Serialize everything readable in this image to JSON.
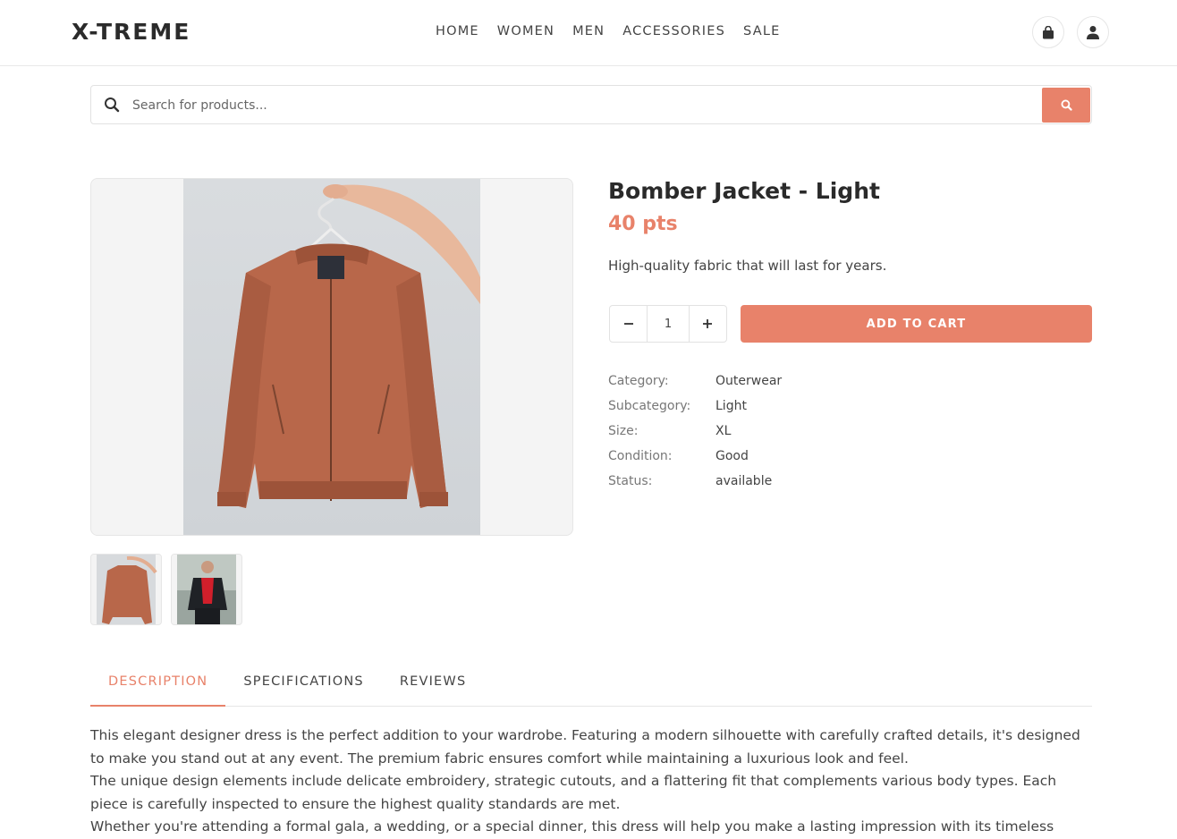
{
  "header": {
    "logo": "X-TREME",
    "nav": [
      "HOME",
      "WOMEN",
      "MEN",
      "ACCESSORIES",
      "SALE"
    ],
    "icons": [
      "shopping-bag-icon",
      "user-icon"
    ]
  },
  "search": {
    "placeholder": "Search for products..."
  },
  "product": {
    "title": "Bomber Jacket - Light",
    "price": "40 pts",
    "short_description": "High-quality fabric that will last for years.",
    "quantity": "1",
    "add_to_cart_label": "ADD TO CART",
    "specs": [
      {
        "label": "Category:",
        "value": "Outerwear"
      },
      {
        "label": "Subcategory:",
        "value": "Light"
      },
      {
        "label": "Size:",
        "value": "XL"
      },
      {
        "label": "Condition:",
        "value": "Good"
      },
      {
        "label": "Status:",
        "value": "available"
      }
    ]
  },
  "tabs": [
    "DESCRIPTION",
    "SPECIFICATIONS",
    "REVIEWS"
  ],
  "description": {
    "paragraphs": [
      "This elegant designer dress is the perfect addition to your wardrobe. Featuring a modern silhouette with carefully crafted details, it's designed to make you stand out at any event. The premium fabric ensures comfort while maintaining a luxurious look and feel.",
      "The unique design elements include delicate embroidery, strategic cutouts, and a flattering fit that complements various body types. Each piece is carefully inspected to ensure the highest quality standards are met.",
      "Whether you're attending a formal gala, a wedding, or a special dinner, this dress will help you make a lasting impression with its timeless"
    ]
  },
  "colors": {
    "accent": "#e8826a",
    "jacket": "#b8674a"
  }
}
